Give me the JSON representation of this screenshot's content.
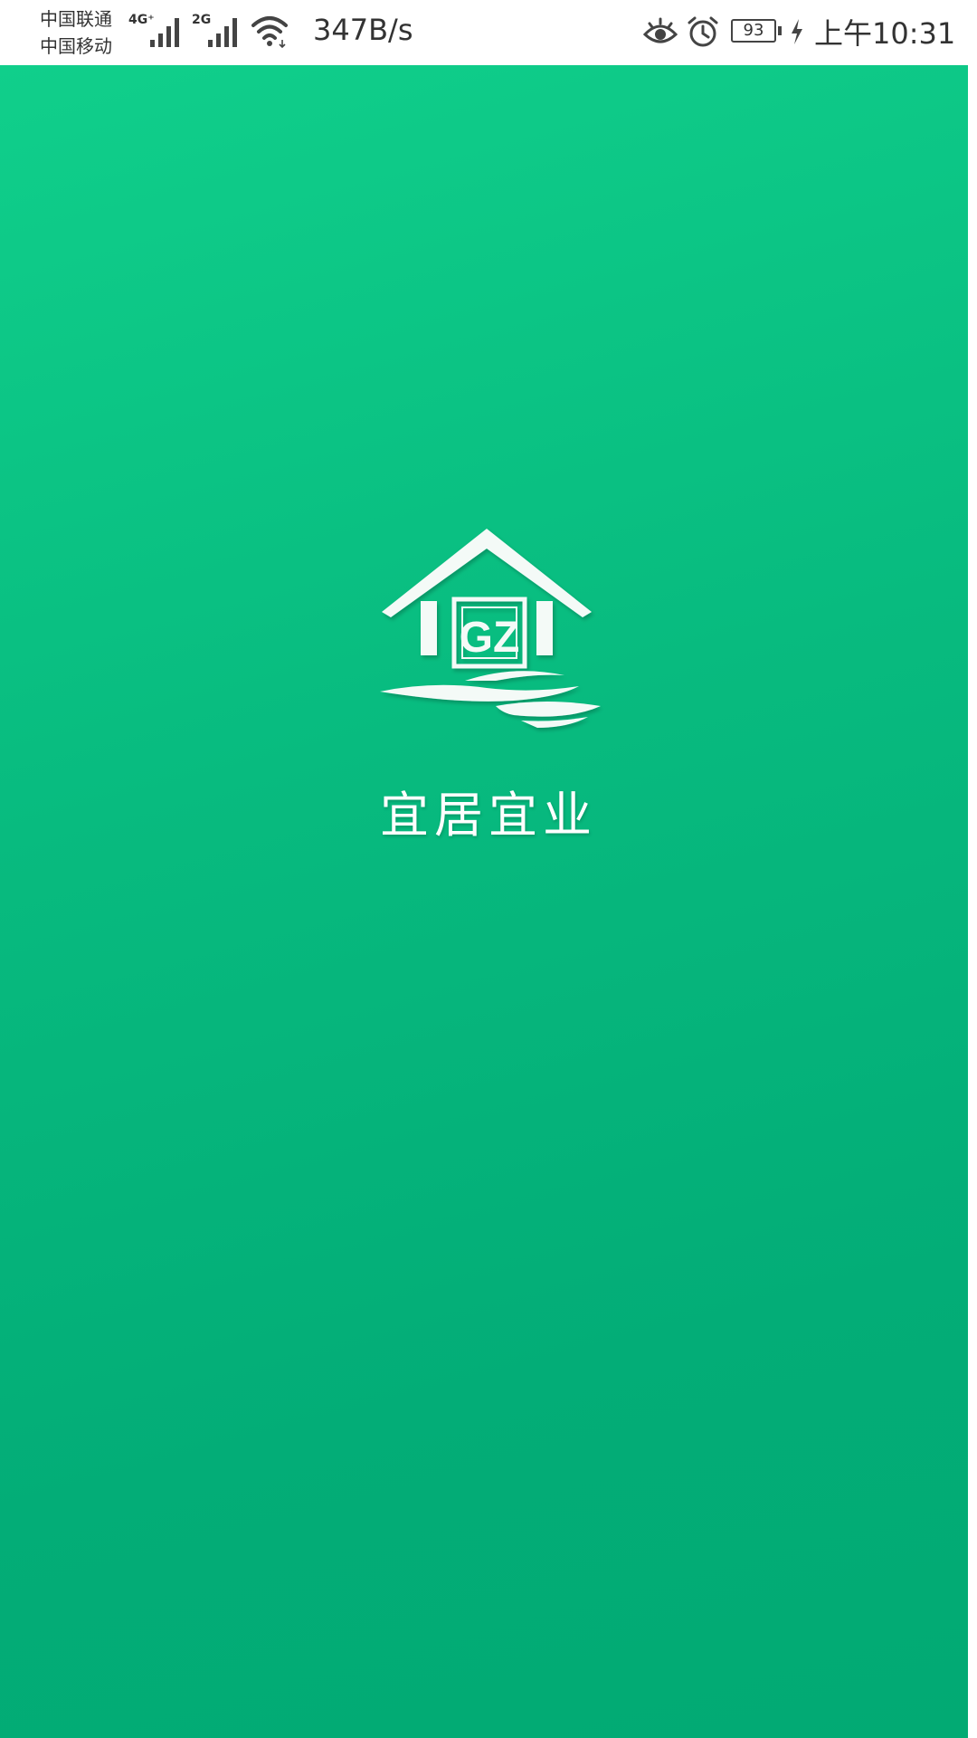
{
  "status_bar": {
    "carrier_1": "中国联通",
    "carrier_2": "中国移动",
    "signal_1_type": "4G⁺",
    "signal_2_type": "2G",
    "net_speed": "347B/s",
    "battery_level": "93",
    "clock": "上午10:31",
    "icons": [
      "signal-icon",
      "wifi-icon",
      "eye-icon",
      "alarm-icon",
      "battery-icon",
      "charging-icon"
    ]
  },
  "splash": {
    "logo_text": "GZ",
    "brand_name": "宜居宜业",
    "colors": {
      "background_top": "#10cf8b",
      "background_bottom": "#02aa73",
      "logo": "#ffffff"
    }
  }
}
